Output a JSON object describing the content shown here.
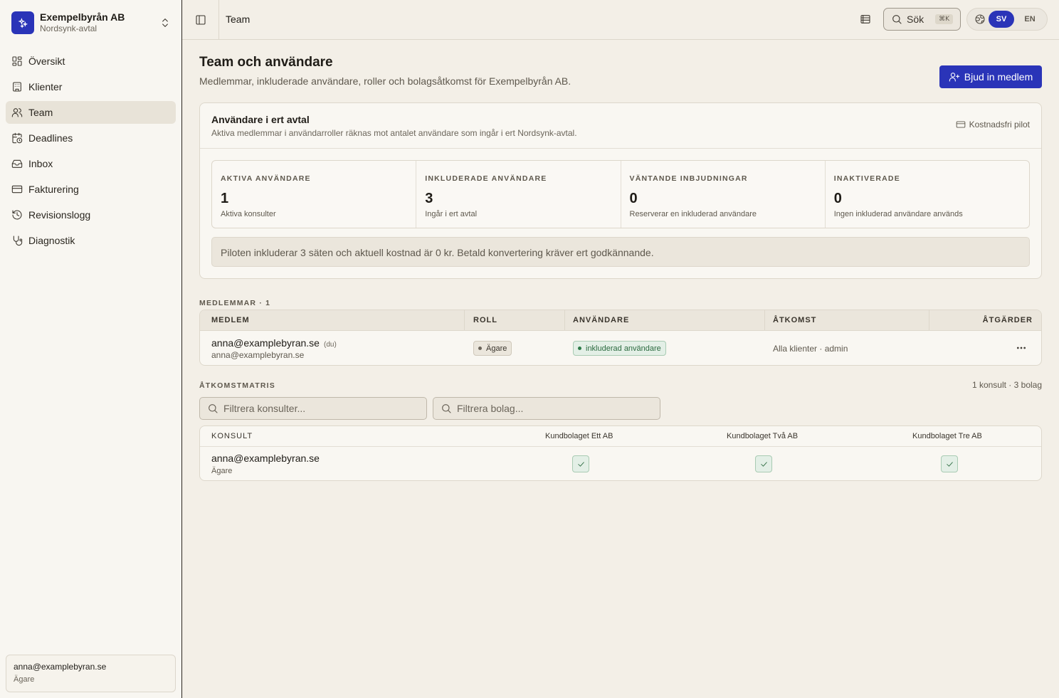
{
  "org": {
    "name": "Exempelbyrån AB",
    "subtitle": "Nordsynk-avtal"
  },
  "nav": [
    {
      "label": "Översikt",
      "icon": "dashboard-icon"
    },
    {
      "label": "Klienter",
      "icon": "building-icon"
    },
    {
      "label": "Team",
      "icon": "users-icon",
      "active": true
    },
    {
      "label": "Deadlines",
      "icon": "calendar-clock-icon"
    },
    {
      "label": "Inbox",
      "icon": "inbox-icon"
    },
    {
      "label": "Fakturering",
      "icon": "credit-card-icon"
    },
    {
      "label": "Revisionslogg",
      "icon": "history-icon"
    },
    {
      "label": "Diagnostik",
      "icon": "stethoscope-icon"
    }
  ],
  "user": {
    "email": "anna@examplebyran.se",
    "role": "Ägare"
  },
  "topbar": {
    "title": "Team",
    "search_label": "Sök",
    "search_shortcut": "⌘K",
    "lang_options": [
      "SV",
      "EN"
    ],
    "lang_active": "SV"
  },
  "page": {
    "title": "Team och användare",
    "subtitle": "Medlemmar, inkluderade användare, roller och bolagsåtkomst för Exempelbyrån AB.",
    "invite_label": "Bjud in medlem"
  },
  "seats": {
    "title": "Användare i ert avtal",
    "description": "Aktiva medlemmar i användarroller räknas mot antalet användare som ingår i ert Nordsynk-avtal.",
    "pilot_label": "Kostnadsfri pilot",
    "stats": [
      {
        "label": "AKTIVA ANVÄNDARE",
        "value": "1",
        "note": "Aktiva konsulter"
      },
      {
        "label": "INKLUDERADE ANVÄNDARE",
        "value": "3",
        "note": "Ingår i ert avtal"
      },
      {
        "label": "VÄNTANDE INBJUDNINGAR",
        "value": "0",
        "note": "Reserverar en inkluderad användare"
      },
      {
        "label": "INAKTIVERADE",
        "value": "0",
        "note": "Ingen inkluderad användare används"
      }
    ],
    "notice": "Piloten inkluderar 3 säten och aktuell kostnad är 0 kr. Betald konvertering kräver ert godkännande."
  },
  "members": {
    "section_label": "MEDLEMMAR · 1",
    "columns": [
      "MEDLEM",
      "ROLL",
      "ANVÄNDARE",
      "ÅTKOMST",
      "ÅTGÄRDER"
    ],
    "rows": [
      {
        "email": "anna@examplebyran.se",
        "you_tag": "(du)",
        "sub": "anna@examplebyran.se",
        "role": "Ägare",
        "user_status": "inkluderad användare",
        "access": "Alla klienter · admin"
      }
    ]
  },
  "matrix": {
    "section_label": "ÅTKOMSTMATRIS",
    "count": "1 konsult · 3 bolag",
    "filter_consultants_placeholder": "Filtrera konsulter...",
    "filter_companies_placeholder": "Filtrera bolag...",
    "columns": [
      "KONSULT",
      "Kundbolaget Ett AB",
      "Kundbolaget Två AB",
      "Kundbolaget Tre AB"
    ],
    "rows": [
      {
        "name": "anna@examplebyran.se",
        "role": "Ägare",
        "access": [
          true,
          true,
          true
        ]
      }
    ]
  },
  "colors": {
    "accent": "#2a34b8",
    "success": "#2c6b40",
    "background": "#f3efe7"
  }
}
